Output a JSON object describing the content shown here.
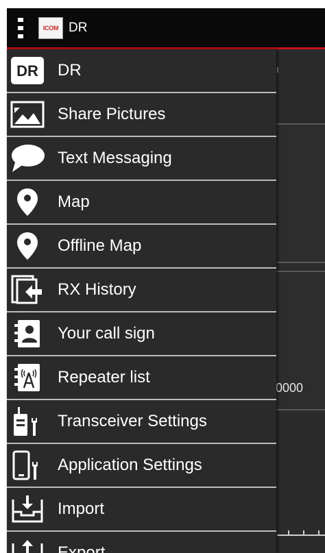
{
  "appbar": {
    "title": "DR",
    "logo_text": "ICOM"
  },
  "background": {
    "frequency_fragment": "0000"
  },
  "drawer": {
    "items": [
      {
        "label": "DR",
        "icon": "dr-badge-icon"
      },
      {
        "label": "Share Pictures",
        "icon": "picture-icon"
      },
      {
        "label": "Text Messaging",
        "icon": "speech-bubble-icon"
      },
      {
        "label": "Map",
        "icon": "map-pin-icon"
      },
      {
        "label": "Offline Map",
        "icon": "map-pin-icon"
      },
      {
        "label": "RX History",
        "icon": "history-icon"
      },
      {
        "label": "Your call sign",
        "icon": "contact-book-icon"
      },
      {
        "label": "Repeater list",
        "icon": "antenna-book-icon"
      },
      {
        "label": "Transceiver Settings",
        "icon": "radio-wrench-icon"
      },
      {
        "label": "Application Settings",
        "icon": "phone-wrench-icon"
      },
      {
        "label": "Import",
        "icon": "import-tray-icon"
      },
      {
        "label": "Export",
        "icon": "export-tray-icon"
      }
    ]
  },
  "colors": {
    "accent": "#c8101a",
    "drawer_bg": "#2a2a2a",
    "appbar_bg": "#0a0a0a"
  }
}
